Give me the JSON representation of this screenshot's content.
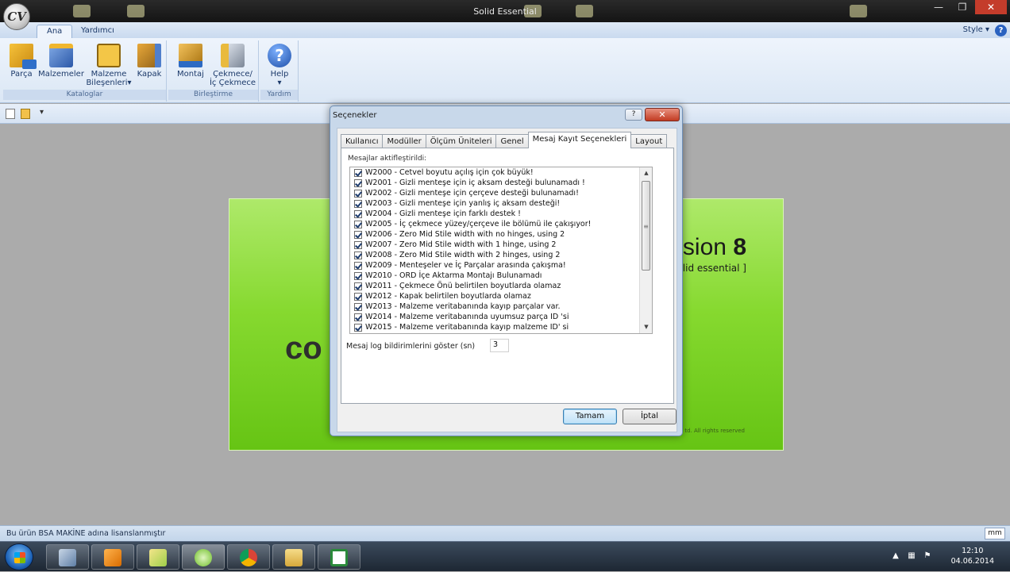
{
  "window": {
    "title": "Solid Essential"
  },
  "ribbon": {
    "tabs": [
      "Ana",
      "Yardımcı"
    ],
    "style_menu": "Style",
    "help_symbol": "?",
    "groups": {
      "kataloglar": "Kataloglar",
      "birlestirme": "Birleştirme",
      "yardim": "Yardım"
    },
    "buttons": {
      "parca": "Parça",
      "malzemeler": "Malzemeler",
      "malzeme_bilesenleri_1": "Malzeme",
      "malzeme_bilesenleri_2": "Bileşenleri",
      "kapak": "Kapak",
      "montaj": "Montaj",
      "cekmece_1": "Çekmece/",
      "cekmece_2": "İç Çekmece",
      "help": "Help"
    }
  },
  "splash": {
    "version_prefix": "sion",
    "version_number": "8",
    "product": "olid essential ]",
    "logo_fragment": "co",
    "copyright": "td. All rights reserved"
  },
  "dialog": {
    "title": "Seçenekler",
    "tabs": [
      "Kullanıcı",
      "Modüller",
      "Ölçüm Üniteleri",
      "Genel",
      "Mesaj Kayıt Seçenekleri",
      "Layout"
    ],
    "active_tab": "Mesaj Kayıt Seçenekleri",
    "panel_label": "Mesajlar aktifleştirildi:",
    "messages": [
      "W2000 - Cetvel boyutu açılış için çok büyük!",
      "W2001 - Gizli menteşe için iç aksam desteği bulunamadı !",
      "W2002 - Gizli menteşe için çerçeve desteği bulunamadı!",
      "W2003 - Gizli menteşe için yanlış iç aksam desteği!",
      "W2004 - Gizli menteşe için farklı destek !",
      "W2005 - İç çekmece yüzey/çerçeve ile bölümü ile çakışıyor!",
      "W2006 - Zero Mid Stile width with no hinges, using 2",
      "W2007 - Zero Mid Stile width with 1 hinge, using 2",
      "W2008 - Zero Mid Stile width with 2 hinges, using 2",
      "W2009 - Menteşeler ve İç Parçalar arasında çakışma!",
      "W2010 - ORD İçe Aktarma Montajı Bulunamadı",
      "W2011 - Çekmece Önü belirtilen boyutlarda olamaz",
      "W2012 - Kapak belirtilen boyutlarda olamaz",
      "W2013 - Malzeme veritabanında kayıp parçalar var.",
      "W2014 - Malzeme veritabanında uyumsuz parça ID 'si",
      "W2015 - Malzeme veritabanında kayıp malzeme ID' si"
    ],
    "log_label": "Mesaj log bildirimlerini göster (sn)",
    "log_value": "3",
    "ok": "Tamam",
    "cancel": "İptal",
    "help_btn": "?",
    "close_btn": "✕"
  },
  "statusbar": {
    "text": "Bu ürün BSA MAKİNE adına lisanslanmıştır",
    "unit": "mm"
  },
  "taskbar": {
    "time": "12:10",
    "date": "04.06.2014"
  },
  "colors": {
    "splash_green": "#86d92f",
    "ribbon_bg": "#dbe7f5",
    "dialog_frame": "#c8d8ea"
  }
}
